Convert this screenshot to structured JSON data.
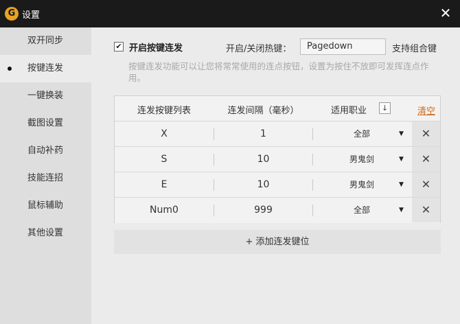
{
  "window": {
    "title": "设置",
    "logo_glyph": "G",
    "close_glyph": "✕"
  },
  "sidebar": {
    "items": [
      {
        "label": "双开同步"
      },
      {
        "label": "按键连发"
      },
      {
        "label": "一键换装"
      },
      {
        "label": "截图设置"
      },
      {
        "label": "自动补药"
      },
      {
        "label": "技能连招"
      },
      {
        "label": "鼠标辅助"
      },
      {
        "label": "其他设置"
      }
    ],
    "active_index": 1
  },
  "settings": {
    "enable_label": "开启按键连发",
    "enable_checked": true,
    "checkbox_glyph": "✔",
    "hotkey_label": "开启/关闭热键：",
    "hotkey_value": "Pagedown",
    "combo_label": "支持组合键",
    "description": "按键连发功能可以让您将常常使用的连点按钮，设置为按住不放即可发挥连点作用。"
  },
  "table": {
    "headers": {
      "key": "连发按键列表",
      "interval": "连发间隔（毫秒）",
      "job": "适用职业",
      "sort_glyph": "↓",
      "clear": "清空"
    },
    "rows": [
      {
        "key": "X",
        "interval": "1",
        "job": "全部"
      },
      {
        "key": "S",
        "interval": "10",
        "job": "男鬼剑"
      },
      {
        "key": "E",
        "interval": "10",
        "job": "男鬼剑"
      },
      {
        "key": "Num0",
        "interval": "999",
        "job": "全部"
      }
    ],
    "dropdown_glyph": "▼",
    "delete_glyph": "✕"
  },
  "add_button": {
    "label": "+ 添加连发键位"
  }
}
